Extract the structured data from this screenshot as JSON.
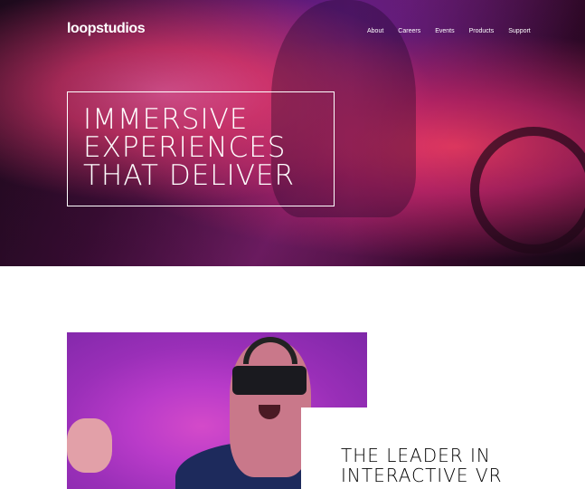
{
  "header": {
    "logo": "loopstudios",
    "nav": [
      "About",
      "Careers",
      "Events",
      "Products",
      "Support"
    ]
  },
  "hero": {
    "headline_lines": [
      "IMMERSIVE",
      "EXPERIENCES",
      "THAT DELIVER"
    ]
  },
  "feature": {
    "title_lines": [
      "THE LEADER IN",
      "INTERACTIVE VR"
    ]
  },
  "colors": {
    "hero_accent": "#e83a7a",
    "feature_image_bg": "#b93bc9",
    "text_dark": "#000000",
    "text_light": "#ffffff"
  }
}
